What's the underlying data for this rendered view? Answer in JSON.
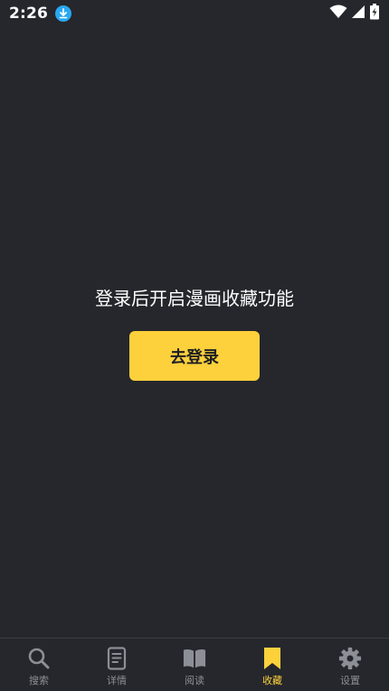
{
  "status_bar": {
    "time": "2:26"
  },
  "main": {
    "message": "登录后开启漫画收藏功能",
    "login_button": "去登录"
  },
  "nav": {
    "items": [
      {
        "label": "搜索",
        "icon": "search-icon"
      },
      {
        "label": "详情",
        "icon": "document-icon"
      },
      {
        "label": "阅读",
        "icon": "book-icon"
      },
      {
        "label": "收藏",
        "icon": "bookmark-icon",
        "active": true
      },
      {
        "label": "设置",
        "icon": "gear-icon"
      }
    ]
  },
  "colors": {
    "background": "#25272c",
    "accent": "#fdd13c",
    "inactive": "#8c8f96"
  }
}
